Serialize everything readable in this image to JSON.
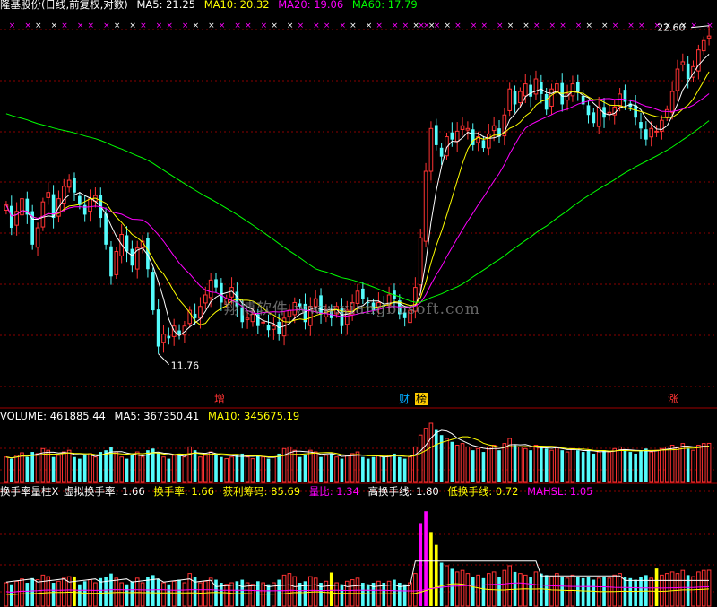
{
  "main_panel": {
    "title": "隆基股份(日线,前复权,对数)",
    "indicators": [
      {
        "name": "MA5",
        "value": "21.25",
        "color": "#ffffff"
      },
      {
        "name": "MA10",
        "value": "20.32",
        "color": "#ffff00"
      },
      {
        "name": "MA20",
        "value": "19.06",
        "color": "#ff00ff"
      },
      {
        "name": "MA60",
        "value": "17.79",
        "color": "#00ff00"
      }
    ],
    "high_label": "22.60",
    "low_label": "11.76",
    "badges": [
      {
        "text": "增",
        "color": "#ff3333",
        "bg": "#000000"
      },
      {
        "text": "财",
        "color": "#00aaff",
        "bg": "#000000"
      },
      {
        "text": "榜",
        "color": "#000000",
        "bg": "#ffcc00"
      },
      {
        "text": "涨",
        "color": "#ff3333",
        "bg": "#000000"
      }
    ],
    "watermark": "翔博软件 www.xiangbosoft.com"
  },
  "volume_panel": {
    "label": "VOLUME",
    "value": "461885.44",
    "indicators": [
      {
        "name": "MA5",
        "value": "367350.41",
        "color": "#ffffff"
      },
      {
        "name": "MA10",
        "value": "345675.19",
        "color": "#ffff00"
      }
    ]
  },
  "turnover_panel": {
    "title": "换手率量柱X",
    "items": [
      {
        "name": "虚拟换手率",
        "value": "1.66",
        "color": "#ffffff"
      },
      {
        "name": "换手率",
        "value": "1.66",
        "color": "#ffff00"
      },
      {
        "name": "获利筹码",
        "value": "85.69",
        "color": "#ffff00"
      },
      {
        "name": "量比",
        "value": "1.34",
        "color": "#ff00ff"
      },
      {
        "name": "高换手线",
        "value": "1.80",
        "color": "#ffffff"
      },
      {
        "name": "低换手线",
        "value": "0.72",
        "color": "#ffff00"
      },
      {
        "name": "MAHSL",
        "value": "1.05",
        "color": "#ff00ff"
      }
    ]
  },
  "colors": {
    "up": "#ff3333",
    "down": "#54fcfc",
    "grid": "#8b0000"
  },
  "chart_data": {
    "type": "candlestick",
    "scale": "log",
    "ylim": [
      11.5,
      23.0
    ],
    "close": [
      16.3,
      15.6,
      16.1,
      16.5,
      16.0,
      15.1,
      15.6,
      16.4,
      16.7,
      15.9,
      16.5,
      16.9,
      17.1,
      16.7,
      16.3,
      16.0,
      16.5,
      16.6,
      15.9,
      15.1,
      14.2,
      14.9,
      15.4,
      14.9,
      14.5,
      15.0,
      15.2,
      14.4,
      13.3,
      12.4,
      12.7,
      12.6,
      12.9,
      12.7,
      12.9,
      13.3,
      13.1,
      13.4,
      13.7,
      14.1,
      13.9,
      13.5,
      13.6,
      13.9,
      13.4,
      13.0,
      13.1,
      13.2,
      12.9,
      13.0,
      12.8,
      12.9,
      12.7,
      13.1,
      13.3,
      13.5,
      13.4,
      13.0,
      13.4,
      13.6,
      13.2,
      13.3,
      13.1,
      13.4,
      12.9,
      13.3,
      13.5,
      13.8,
      13.6,
      13.5,
      13.3,
      13.5,
      13.4,
      13.7,
      13.6,
      13.2,
      13.1,
      13.3,
      13.9,
      15.3,
      17.4,
      18.9,
      18.3,
      17.9,
      18.6,
      18.5,
      18.8,
      19.0,
      18.9,
      18.3,
      18.6,
      18.2,
      18.7,
      19.0,
      18.6,
      19.4,
      20.4,
      19.8,
      20.3,
      20.6,
      20.1,
      20.8,
      20.2,
      19.6,
      20.4,
      20.6,
      19.8,
      20.2,
      20.6,
      20.3,
      19.8,
      19.4,
      19.1,
      19.7,
      19.3,
      19.5,
      19.7,
      20.2,
      19.9,
      19.7,
      19.3,
      18.9,
      18.5,
      18.9,
      18.8,
      19.2,
      19.6,
      20.3,
      21.2,
      21.5,
      20.8,
      21.3,
      22.0,
      22.4,
      22.6
    ],
    "volume_approx_k": [
      300,
      280,
      320,
      350,
      300,
      360,
      340,
      400,
      380,
      300,
      320,
      360,
      380,
      300,
      280,
      320,
      340,
      300,
      360,
      380,
      420,
      360,
      300,
      280,
      320,
      360,
      300,
      380,
      400,
      350,
      300,
      280,
      320,
      340,
      300,
      420,
      380,
      300,
      320,
      360,
      340,
      300,
      280,
      300,
      320,
      340,
      300,
      280,
      320,
      300,
      280,
      300,
      340,
      400,
      420,
      380,
      300,
      320,
      380,
      360,
      300,
      320,
      340,
      300,
      280,
      320,
      340,
      360,
      300,
      280,
      300,
      320,
      300,
      320,
      340,
      300,
      280,
      300,
      420,
      560,
      640,
      700,
      620,
      560,
      520,
      480,
      440,
      460,
      420,
      380,
      400,
      360,
      420,
      440,
      380,
      460,
      520,
      440,
      420,
      400,
      380,
      440,
      420,
      400,
      380,
      420,
      380,
      360,
      400,
      380,
      360,
      380,
      340,
      360,
      380,
      360,
      400,
      420,
      380,
      360,
      340,
      380,
      400,
      360,
      380,
      400,
      420,
      440,
      420,
      460,
      400,
      380,
      440,
      460,
      462
    ]
  }
}
